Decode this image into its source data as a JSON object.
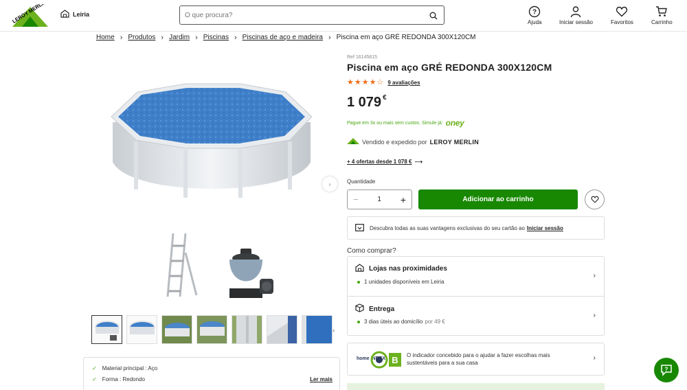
{
  "header": {
    "store_name": "Leiria",
    "search_placeholder": "O que procura?",
    "nav": {
      "help": "Ajuda",
      "login": "Iniciar sessão",
      "favorites": "Favoritos",
      "cart": "Carrinho"
    },
    "logo_text": "LEROY MERLIN"
  },
  "breadcrumb": {
    "items": [
      "Home",
      "Produtos",
      "Jardim",
      "Piscinas",
      "Piscinas de aço e madeira"
    ],
    "current": "Piscina em aço GRÉ REDONDA 300X120CM"
  },
  "product": {
    "ref": "Ref 16145815",
    "title": "Piscina em aço GRÉ REDONDA 300X120CM",
    "rating": 4,
    "rating_max": 5,
    "reviews": "9 avaliações",
    "price": "1 079",
    "currency": "€",
    "oney_text": "Pague em 3x ou mais sem custos. Simule já:",
    "oney_logo": "oney",
    "sold_by_prefix": "Vendido e expedido por",
    "sold_by": "LEROY MERLIN",
    "offers": "+ 4 ofertas desde 1 078 €",
    "quantity_label": "Quantidade",
    "quantity": "1",
    "add_to_cart": "Adicionar ao carrinho",
    "card_promo": "Descubra todas as suas vantagens exclusivas do seu cartão ao",
    "card_promo_link": "Iniciar sessão",
    "how_to_buy": "Como comprar?",
    "stores": {
      "title": "Lojas nas proximidades",
      "detail": "1 unidades disponíveis em Leiria"
    },
    "delivery": {
      "title": "Entrega",
      "detail": "3 dias úteis ao domicílio",
      "price": "por 49 €"
    },
    "home_index": {
      "logo_text": "home INDEX",
      "grade": "B",
      "text": "O indicador concebido para o ajudar a fazer escolhas mais sustentáveis para a sua casa"
    }
  },
  "features": {
    "items": [
      "Material principal : Aço",
      "Forma : Redondo"
    ],
    "read_more": "Ler mais"
  },
  "colors": {
    "brand_green": "#188803",
    "accent_green": "#46a610",
    "star_orange": "#f06e19"
  }
}
